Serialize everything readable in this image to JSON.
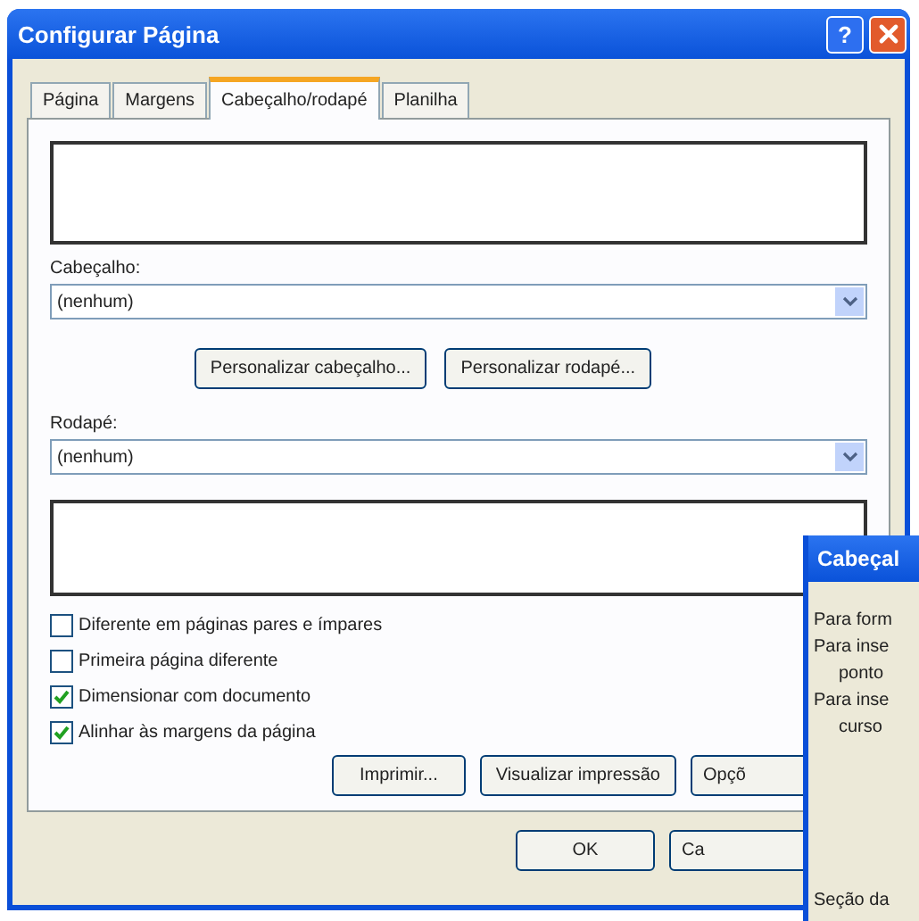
{
  "window": {
    "title": "Configurar Página",
    "help_button": "?"
  },
  "tabs": [
    {
      "label": "Página",
      "selected": false
    },
    {
      "label": "Margens",
      "selected": false
    },
    {
      "label": "Cabeçalho/rodapé",
      "selected": true
    },
    {
      "label": "Planilha",
      "selected": false
    }
  ],
  "header": {
    "label": "Cabeçalho:",
    "value": "(nenhum)"
  },
  "custom_buttons": [
    "Personalizar cabeçalho...",
    "Personalizar rodapé..."
  ],
  "footer": {
    "label": "Rodapé:",
    "value": "(nenhum)"
  },
  "options": [
    {
      "label": "Diferente em páginas pares e ímpares",
      "checked": false
    },
    {
      "label": "Primeira página diferente",
      "checked": false
    },
    {
      "label": "Dimensionar com documento",
      "checked": true
    },
    {
      "label": "Alinhar às margens da página",
      "checked": true
    }
  ],
  "action_buttons": [
    "Imprimir...",
    "Visualizar impressão",
    "Opçõ"
  ],
  "dialog_buttons": [
    "OK",
    "Ca"
  ],
  "overlay_window": {
    "title": "Cabeçal",
    "lines": [
      {
        "text": "Para form",
        "indented": false
      },
      {
        "text": "Para inse",
        "indented": false
      },
      {
        "text": "ponto",
        "indented": true
      },
      {
        "text": "Para inse",
        "indented": false
      },
      {
        "text": "curso",
        "indented": true
      }
    ],
    "bottom_text": "Seção da"
  }
}
